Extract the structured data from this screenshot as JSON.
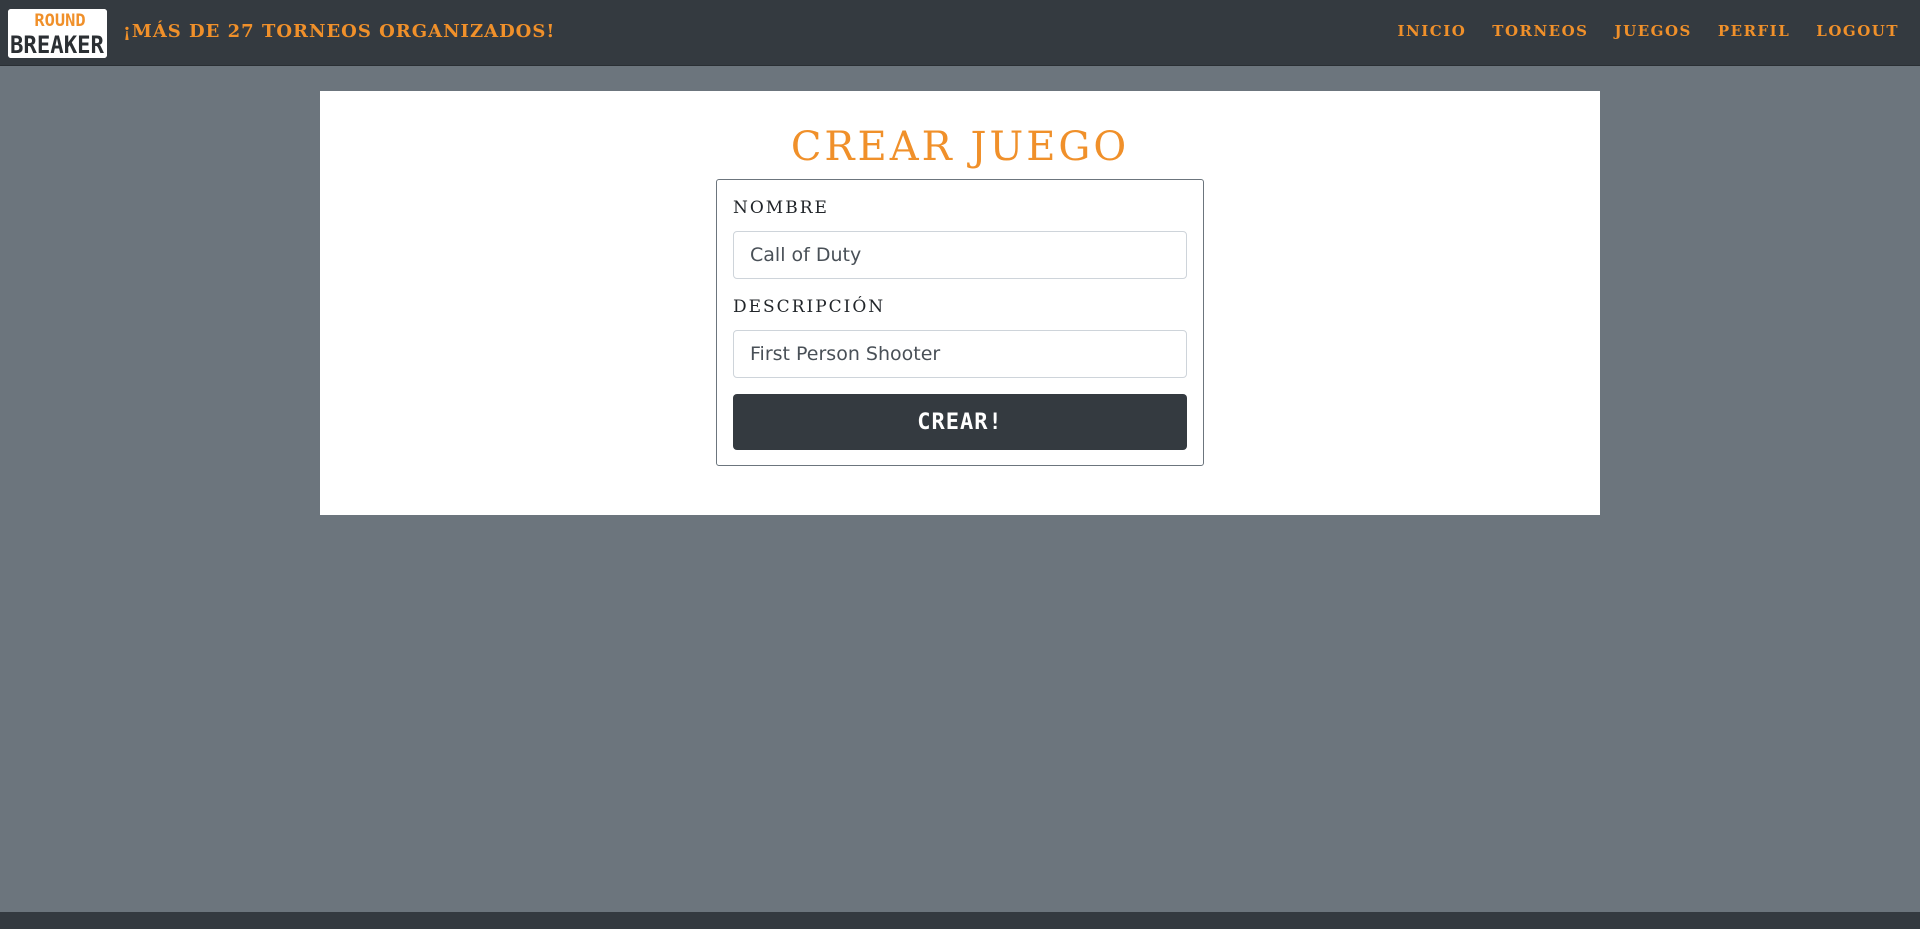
{
  "navbar": {
    "logo": {
      "line1": "ROUND",
      "line2": "BREAKER",
      "icon": "round-breaker-logo"
    },
    "tagline": "¡MÁS DE 27 TORNEOS ORGANIZADOS!",
    "links": [
      "INICIO",
      "TORNEOS",
      "JUEGOS",
      "PERFIL",
      "LOGOUT"
    ]
  },
  "main": {
    "title": "CREAR JUEGO",
    "form": {
      "name_label": "NOMBRE",
      "name_value": "Call of Duty",
      "description_label": "DESCRIPCIÓN",
      "description_value": "First Person Shooter",
      "submit_label": "CREAR!"
    }
  },
  "colors": {
    "accent": "#f0902a",
    "navbar_bg": "#343a40",
    "page_bg": "#6c757d",
    "button_bg": "#343a40"
  }
}
